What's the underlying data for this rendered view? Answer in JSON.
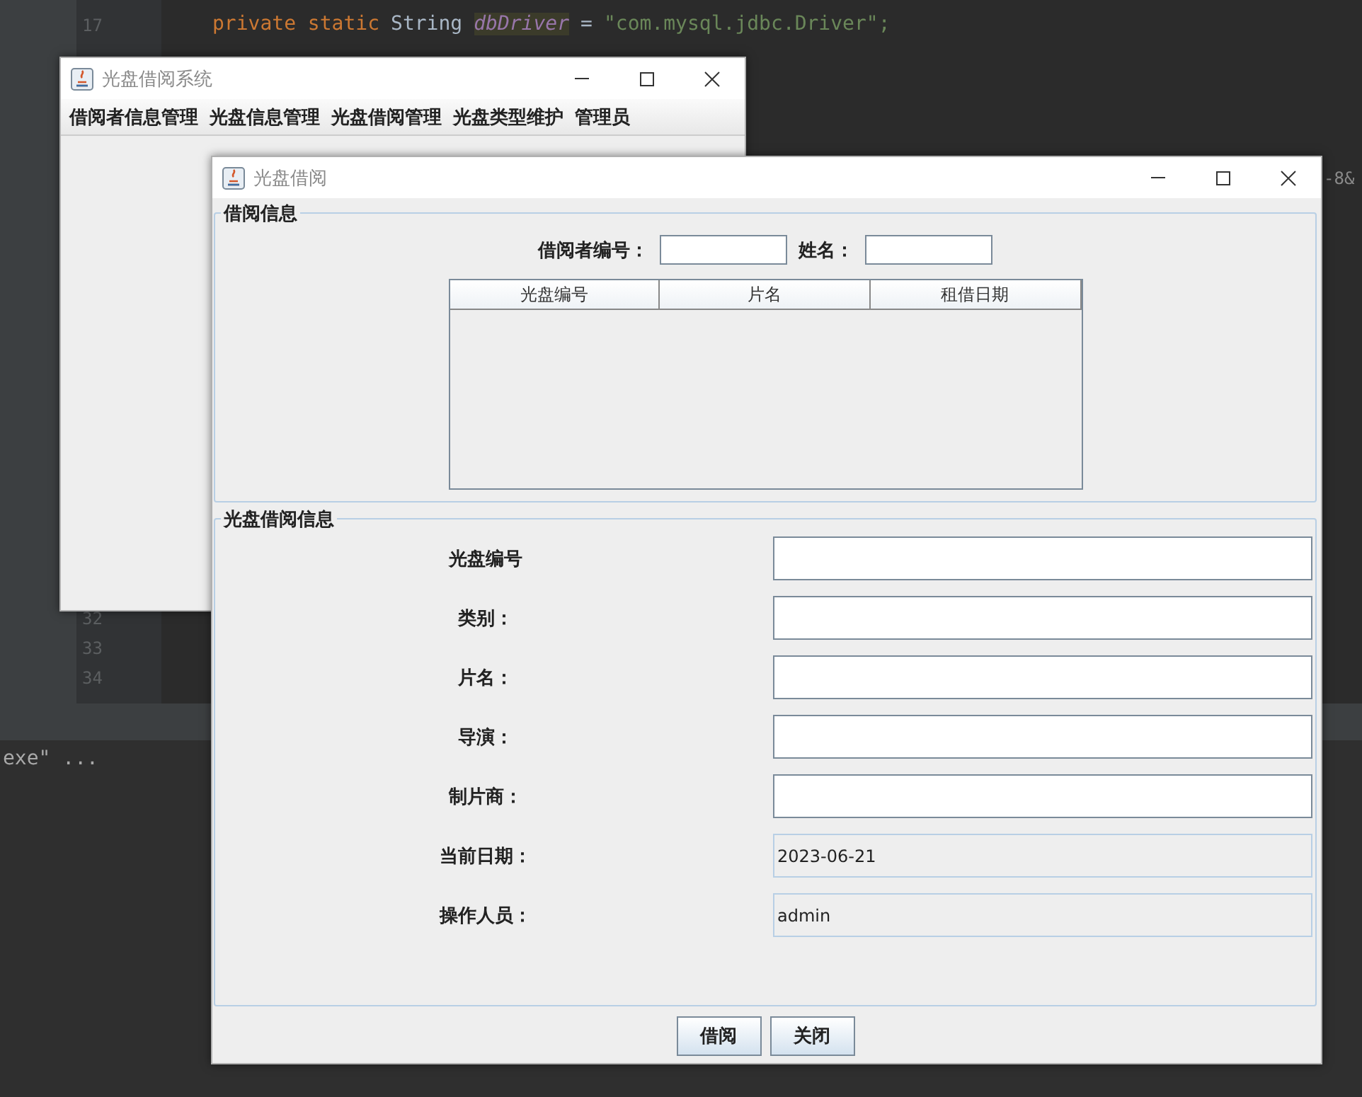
{
  "background": {
    "code_line": [
      {
        "kind": "keyword",
        "text": "private static"
      },
      {
        "kind": "type",
        "text": "String"
      },
      {
        "kind": "field",
        "text": "dbDriver"
      },
      {
        "kind": "operator",
        "text": "="
      },
      {
        "kind": "string",
        "text": "\"com.mysql.jdbc.Driver\";"
      }
    ],
    "top_line_number": "17",
    "line_numbers": [
      "32",
      "33",
      "34"
    ],
    "console_text": "exe\" ...",
    "side_text": "-8&"
  },
  "main_window": {
    "title": "光盘借阅系统",
    "menus": [
      "借阅者信息管理",
      "光盘信息管理",
      "光盘借阅管理",
      "光盘类型维护",
      "管理员"
    ]
  },
  "dialog": {
    "title": "光盘借阅",
    "borrower_panel": {
      "title": "借阅信息",
      "fields": [
        {
          "label": "借阅者编号："
        },
        {
          "label": "姓名："
        }
      ],
      "table": {
        "columns": [
          "光盘编号",
          "片名",
          "租借日期"
        ]
      }
    },
    "disc_panel": {
      "title": "光盘借阅信息",
      "fields": [
        {
          "label": "光盘编号",
          "disabled": false
        },
        {
          "label": "类别：",
          "disabled": false
        },
        {
          "label": "片名：",
          "disabled": false
        },
        {
          "label": "导演：",
          "disabled": false
        },
        {
          "label": "制片商：",
          "disabled": false
        },
        {
          "label": "当前日期：",
          "value": "2023-06-21",
          "disabled": true
        },
        {
          "label": "操作人员：",
          "value": "admin",
          "disabled": true
        }
      ]
    },
    "buttons": [
      "借阅",
      "关闭"
    ]
  }
}
